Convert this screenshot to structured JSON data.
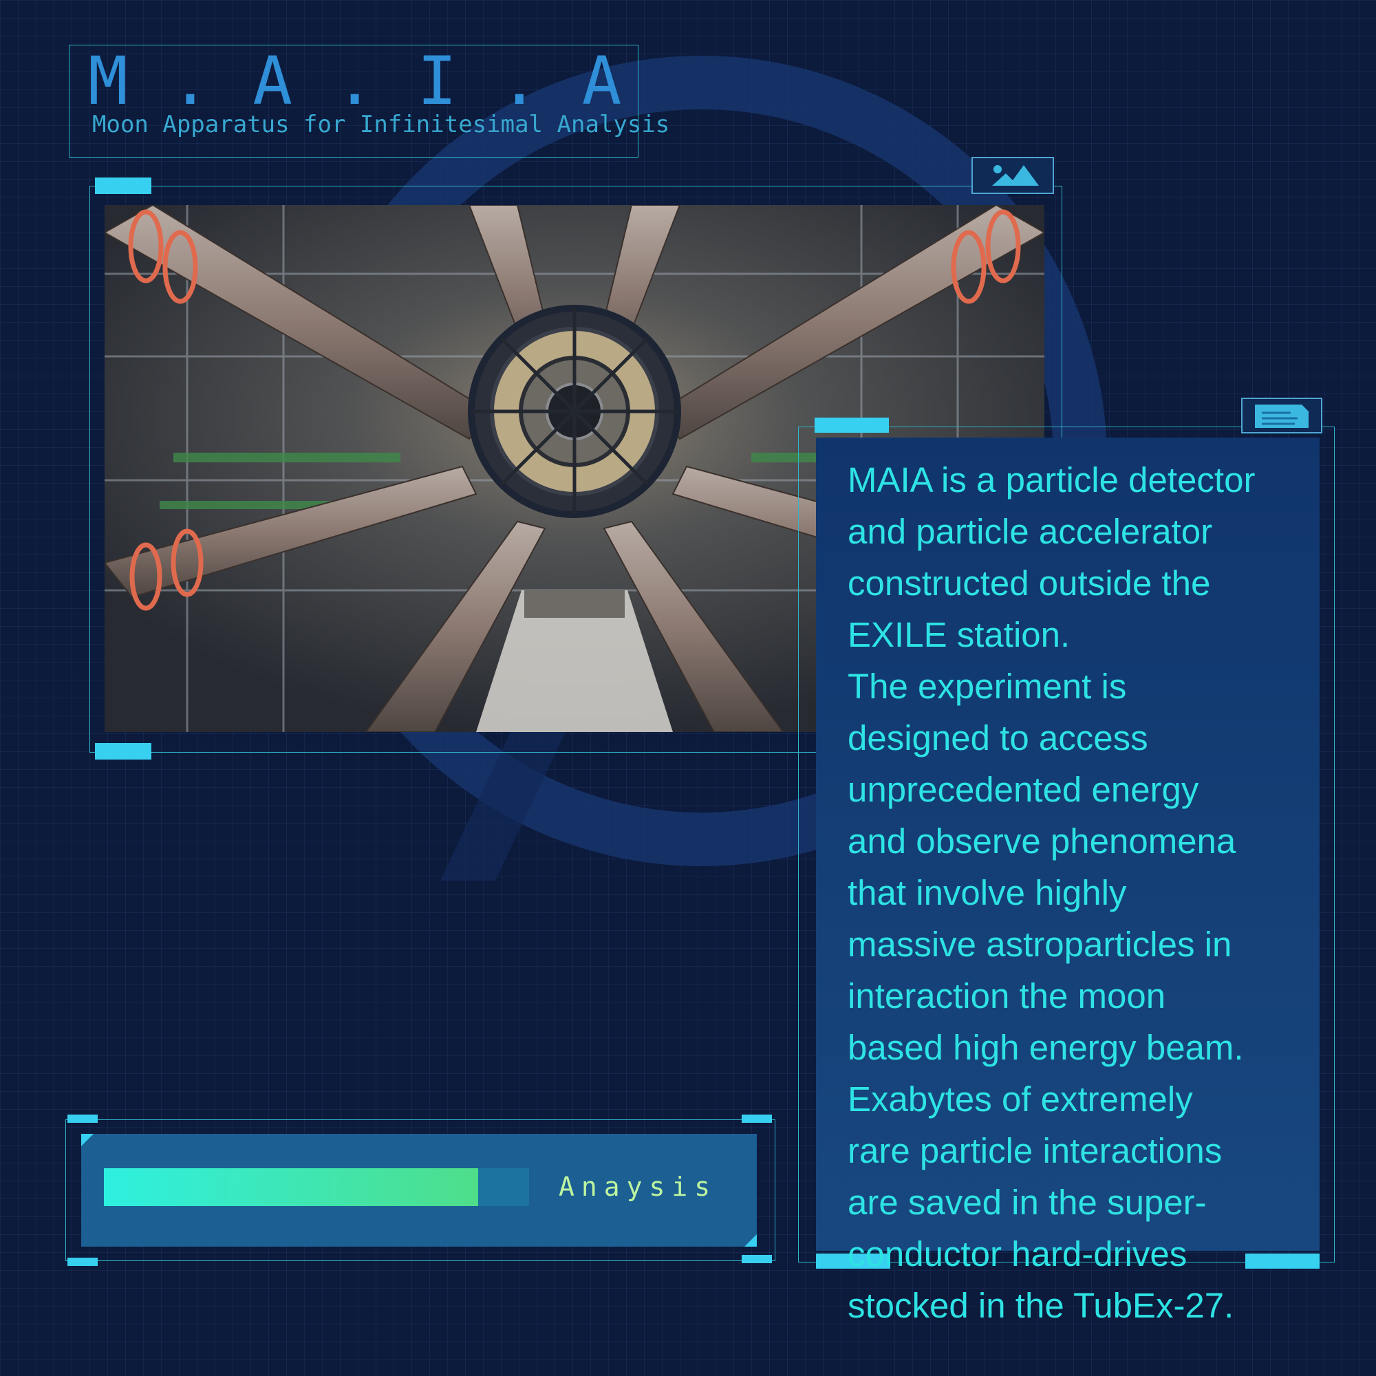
{
  "header": {
    "title": "M . A . I . A",
    "subtitle": "Moon Apparatus for Infinitesimal Analysis"
  },
  "image_panel": {
    "icon": "image-icon",
    "photo": "particle-detector-photo"
  },
  "text_panel": {
    "icon": "document-icon",
    "description": "MAIA is a particle detector\nand particle accelerator\nconstructed outside the\nEXILE station.\nThe experiment is\ndesigned to access\nunprecedented energy\nand observe phenomena\nthat involve highly\nmassive astroparticles in\ninteraction the moon\nbased high energy beam.\nExabytes of extremely\nrare particle interactions\nare saved in the super-\nconductor hard-drives\nstocked in the TubEx-27."
  },
  "progress": {
    "label": "Anaysis",
    "fraction": 0.88
  },
  "colors": {
    "background": "#0c1a3c",
    "accent": "#38d0f0",
    "text_cyan": "#2ee3e4",
    "title_blue": "#2f8fd8",
    "panel_blue": "#1c5f93"
  }
}
